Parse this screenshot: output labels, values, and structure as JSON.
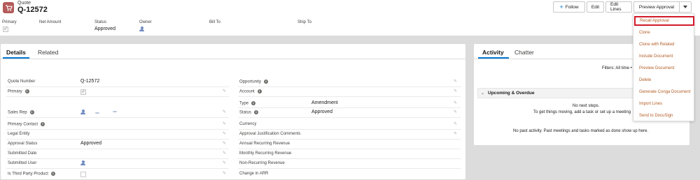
{
  "header": {
    "object_type": "Quote",
    "title": "Q-12572",
    "icon": "cart-icon",
    "accent": "#b45b5b",
    "buttons": {
      "follow": "Follow",
      "edit": "Edit",
      "edit_lines": "Edit Lines",
      "preview_approval": "Preview Approval"
    },
    "highlights": {
      "primary_label": "Primary",
      "net_amount_label": "Net Amount",
      "status_label": "Status",
      "status_value": "Approved",
      "owner_label": "Owner",
      "bill_to_label": "Bill To",
      "ship_to_label": "Ship To"
    }
  },
  "menu": {
    "items": [
      "Recall Approval",
      "Clone",
      "Clone with Related",
      "Include Document",
      "Preview Document",
      "Delete",
      "Generate Conga Document",
      "Import Lines",
      "Send to DocuSign"
    ],
    "selected_index": 0,
    "highlight_color": "#d11a2a"
  },
  "details": {
    "tabs": [
      "Details",
      "Related"
    ],
    "left_fields": {
      "quote_number": {
        "label": "Quote Number",
        "value": "Q-12572"
      },
      "primary": {
        "label": "Primary"
      },
      "sales_rep": {
        "label": "Sales Rep"
      },
      "primary_contact": {
        "label": "Primary Contact"
      },
      "legal_entity": {
        "label": "Legal Entity"
      },
      "approval_status": {
        "label": "Approval Status",
        "value": "Approved"
      },
      "submitted_date": {
        "label": "Submitted Date"
      },
      "submitted_user": {
        "label": "Submitted User"
      },
      "third_party": {
        "label": "Is Third Party Product"
      }
    },
    "right_fields": {
      "opportunity": {
        "label": "Opportunity"
      },
      "account": {
        "label": "Account"
      },
      "type": {
        "label": "Type",
        "value": "Amendment"
      },
      "status": {
        "label": "Status",
        "value": "Approved"
      },
      "currency": {
        "label": "Currency"
      },
      "approval_justification": {
        "label": "Approval Justification Comments"
      },
      "arr": {
        "label": "Annual Recurring Revenue"
      },
      "mrr": {
        "label": "Monthly Recurring Revenue"
      },
      "nrr": {
        "label": "Non-Recurring Revenue"
      },
      "change_arr": {
        "label": "Change in ARR"
      }
    }
  },
  "activity": {
    "tabs": [
      "Activity",
      "Chatter"
    ],
    "filters": "Filters: All time •",
    "refresh_fragment": "R",
    "section_title": "Upcoming & Overdue",
    "no_steps": "No next steps.",
    "get_moving": "To get things moving, add a task or set up a meeting",
    "no_past": "No past activity. Past meetings and tasks marked as done show up here."
  }
}
